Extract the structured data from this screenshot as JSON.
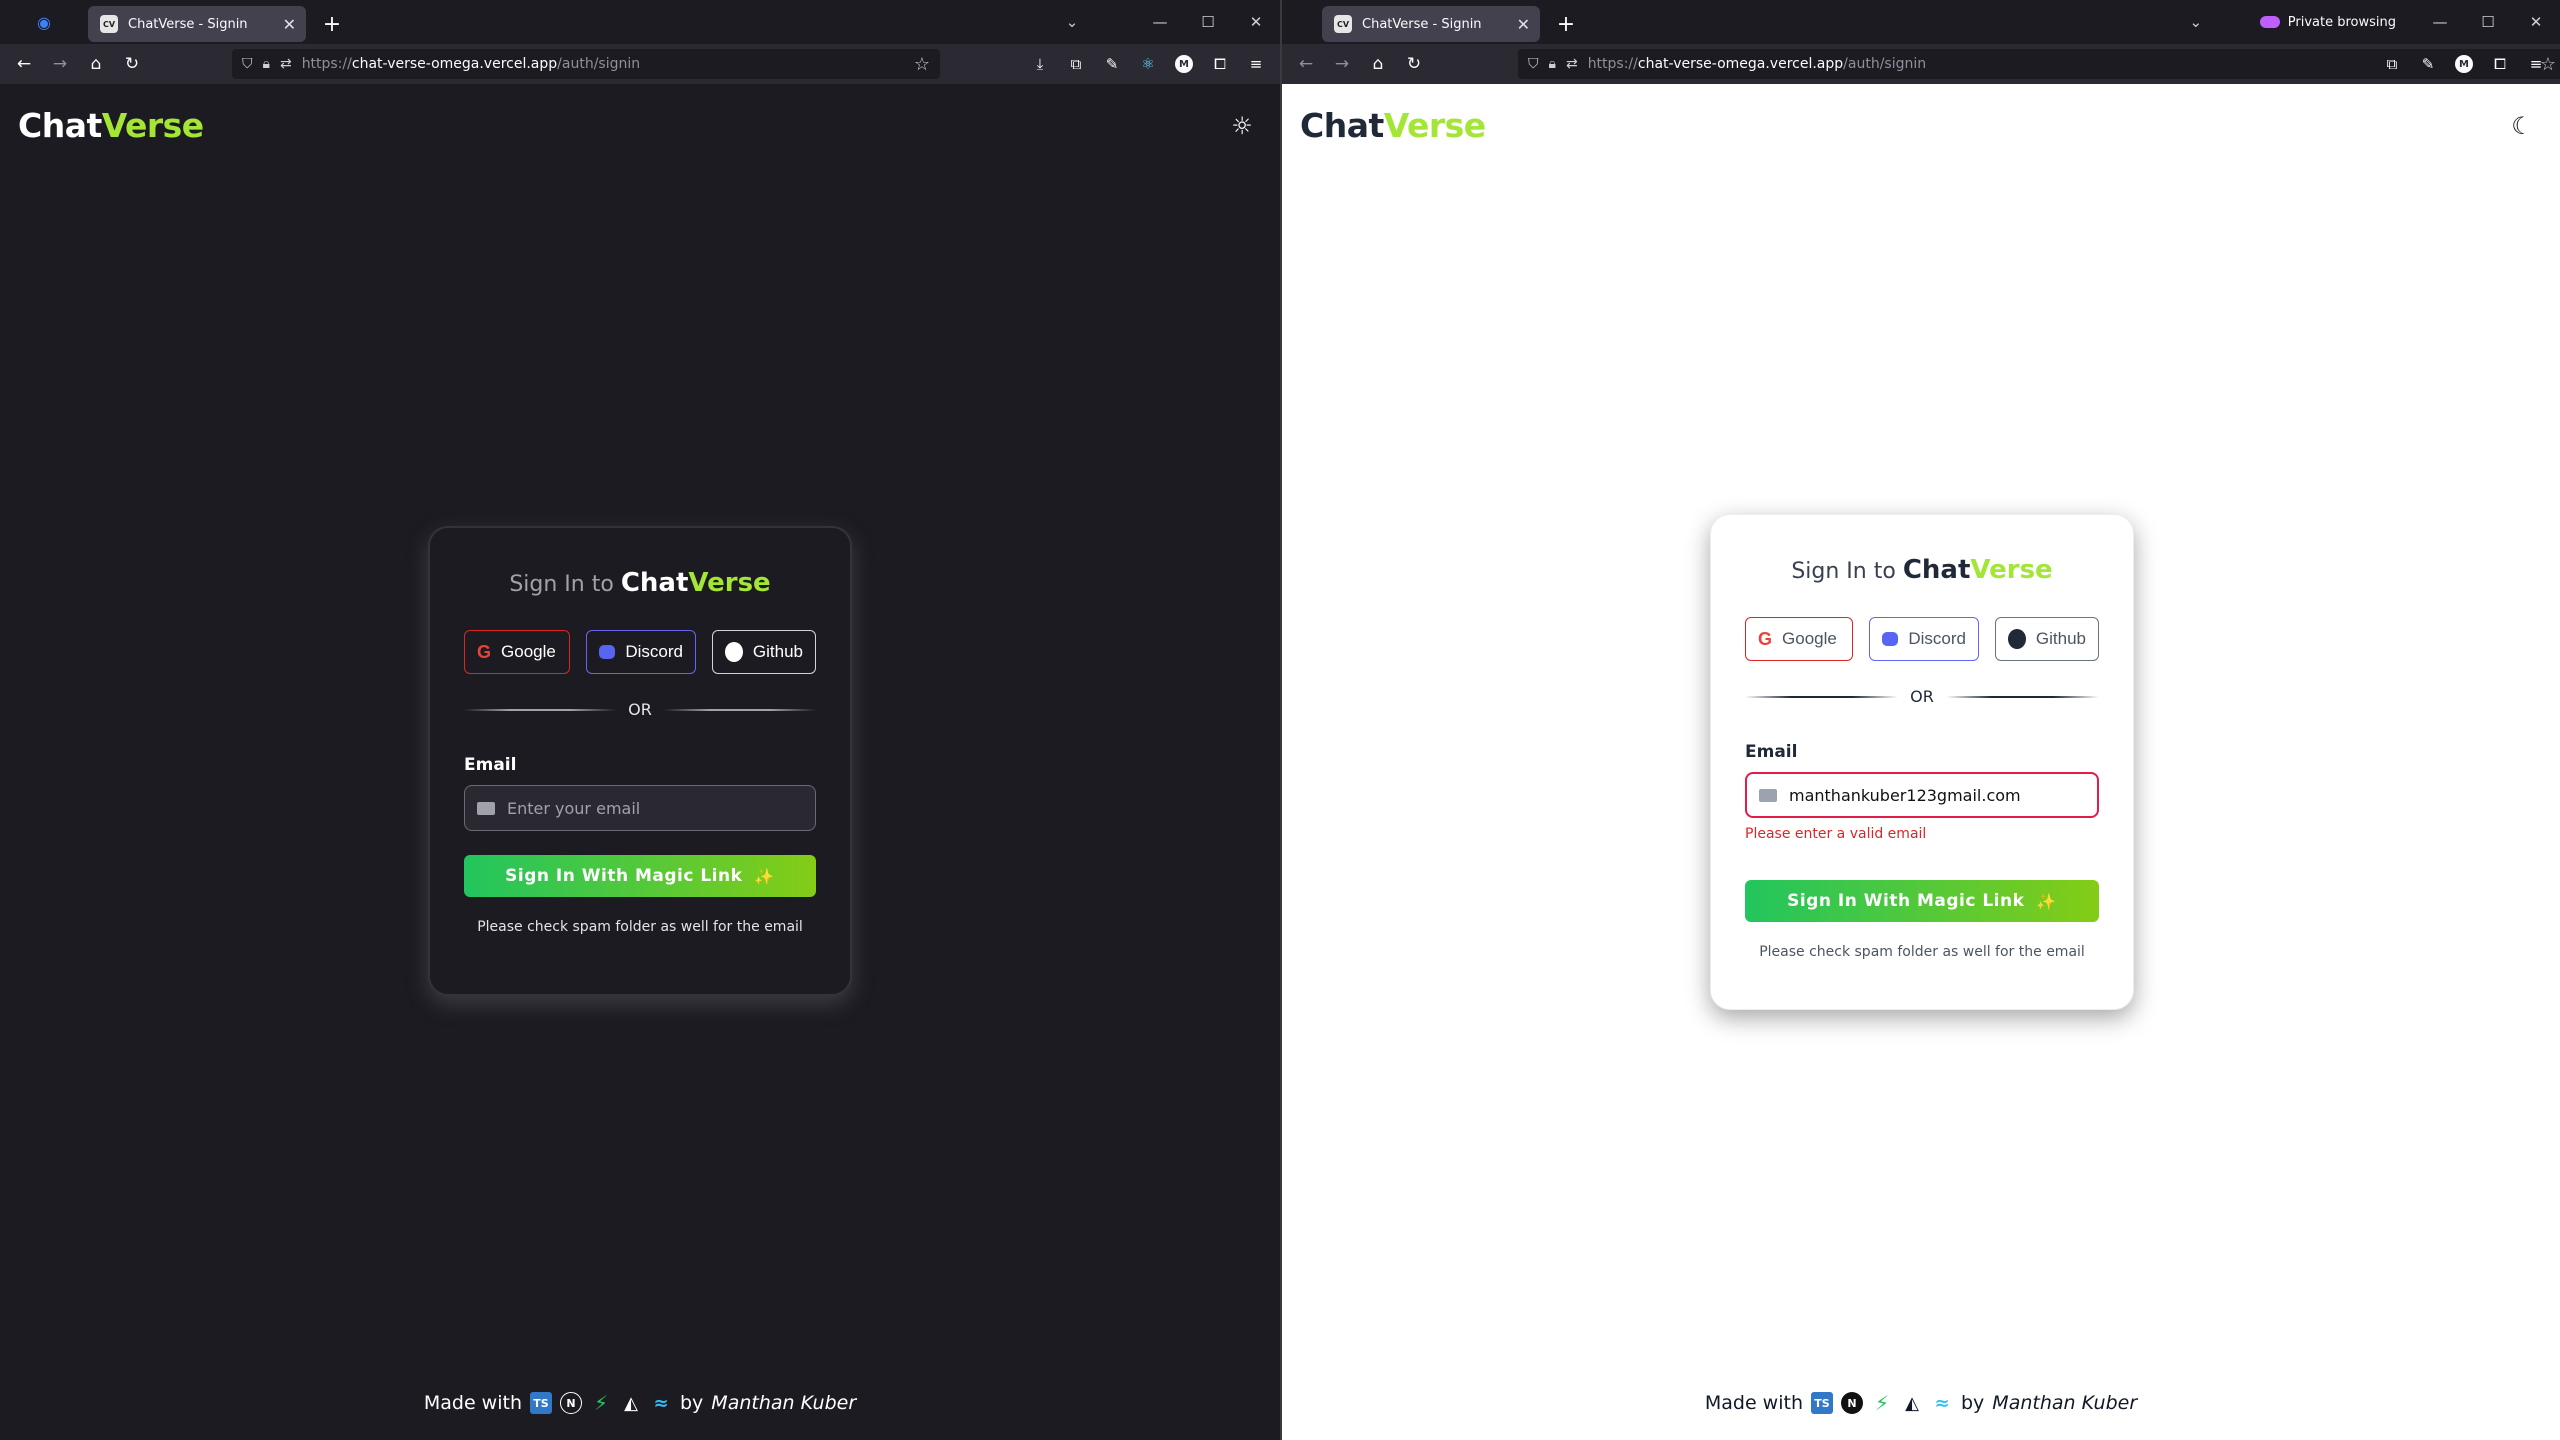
{
  "tab_title": "ChatVerse - Signin",
  "tab_favicon": "CV",
  "url_prefix": "https://",
  "url_host": "chat-verse-omega.vercel.app",
  "url_path": "/auth/signin",
  "private_label": "Private browsing",
  "brand": {
    "part1": "Chat",
    "part2": "Verse"
  },
  "card": {
    "title_prefix": "Sign In to",
    "providers": {
      "google": "Google",
      "discord": "Discord",
      "github": "Github"
    },
    "or_label": "OR",
    "email_label": "Email",
    "email_placeholder": "Enter your email",
    "light_email_value": "manthankuber123gmail.com",
    "error_text": "Please enter a valid email",
    "submit_label": "Sign In With Magic Link",
    "note": "Please check spam folder as well for the email"
  },
  "footer": {
    "made_with": "Made with",
    "by": "by",
    "author": "Manthan Kuber"
  },
  "colors": {
    "accent": "#a3e635",
    "button_start": "#22c55e",
    "button_end": "#84cc16",
    "error": "#dc2626"
  }
}
